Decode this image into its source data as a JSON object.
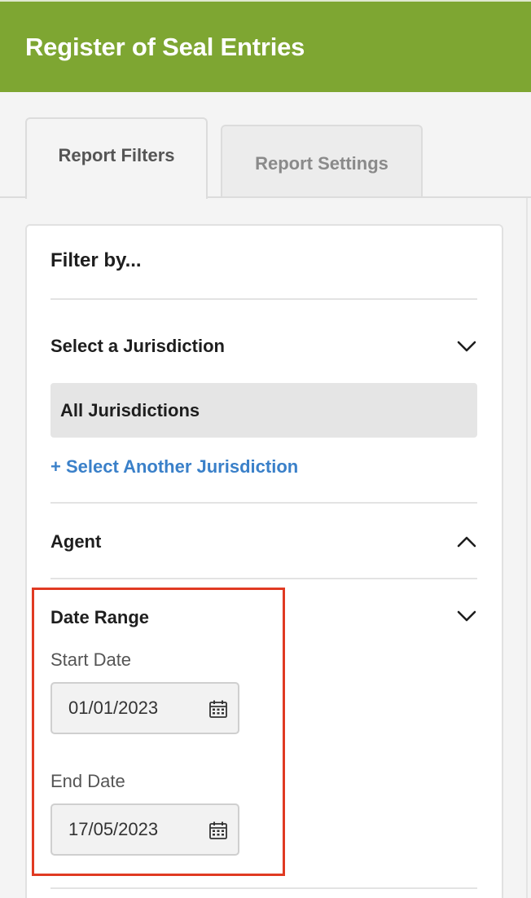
{
  "header": {
    "title": "Register of Seal Entries",
    "bg_color": "#7ea632"
  },
  "tabs": [
    {
      "label": "Report Filters",
      "active": true
    },
    {
      "label": "Report Settings",
      "active": false
    }
  ],
  "filter": {
    "title": "Filter by...",
    "jurisdiction": {
      "label": "Select a Jurisdiction",
      "chevron": "chevron-down-icon",
      "selected": "All Jurisdictions",
      "add_link": "+ Select Another Jurisdiction",
      "link_color": "#3a80c9"
    },
    "agent": {
      "label": "Agent",
      "chevron": "chevron-up-icon"
    },
    "date_range": {
      "label": "Date Range",
      "chevron": "chevron-down-icon",
      "start_label": "Start Date",
      "start_value": "01/01/2023",
      "end_label": "End Date",
      "end_value": "17/05/2023",
      "icon": "calendar-icon",
      "highlight_color": "#e03a22"
    }
  }
}
